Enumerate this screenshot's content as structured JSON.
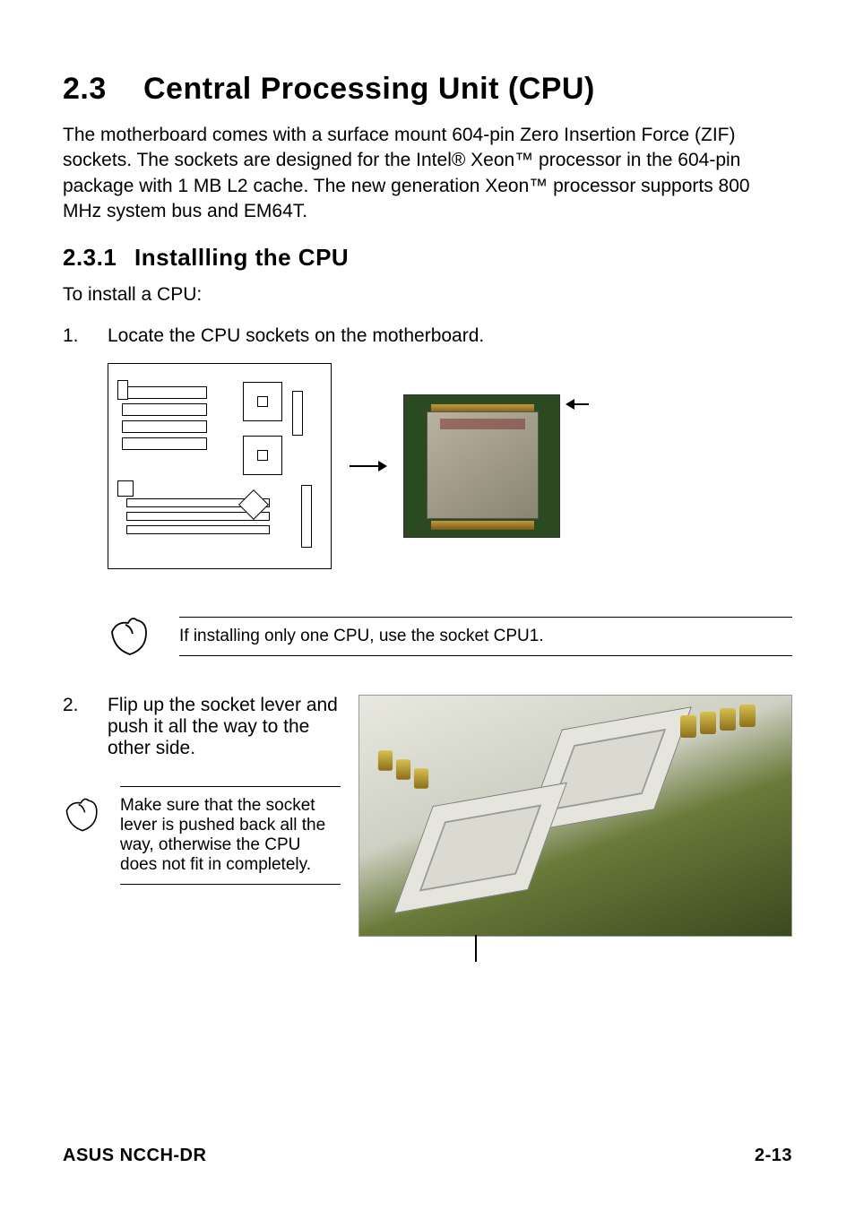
{
  "heading": {
    "number": "2.3",
    "title": "Central Processing Unit (CPU)"
  },
  "intro": "The motherboard comes with a surface mount 604-pin Zero Insertion Force (ZIF) sockets. The sockets are designed for the Intel® Xeon™ processor in the 604-pin package with 1 MB L2 cache. The new generation Xeon™ processor supports 800 MHz system bus and EM64T.",
  "subheading": {
    "number": "2.3.1",
    "title": "Installling the CPU"
  },
  "install_intro": "To install a CPU:",
  "steps": {
    "s1": {
      "num": "1.",
      "text": "Locate the CPU sockets on the motherboard."
    },
    "s2": {
      "num": "2.",
      "text": "Flip up the socket lever and push it all the way to the other side."
    }
  },
  "notes": {
    "n1": "If installing only one CPU, use the socket CPU1.",
    "n2": "Make sure that the socket lever is pushed back all the way, otherwise the CPU does not fit in completely."
  },
  "footer": {
    "left": "ASUS NCCH-DR",
    "right": "2-13"
  }
}
